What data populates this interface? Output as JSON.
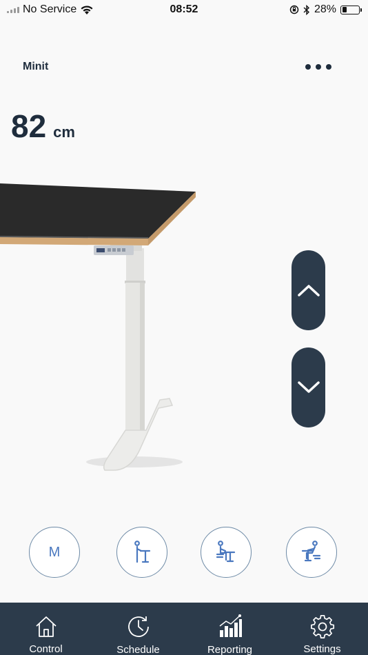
{
  "status_bar": {
    "carrier": "No Service",
    "time": "08:52",
    "battery_percent": "28%",
    "battery_level": 0.28
  },
  "header": {
    "desk_name": "Minit",
    "more_icon": "ellipsis-icon"
  },
  "height": {
    "value": "82",
    "unit": "cm"
  },
  "controls": {
    "up_icon": "chevron-up-icon",
    "down_icon": "chevron-down-icon"
  },
  "presets": {
    "memory_label": "M",
    "items": [
      {
        "icon": "standing-person-icon"
      },
      {
        "icon": "sitting-person-icon"
      },
      {
        "icon": "sitting-lower-person-icon"
      }
    ]
  },
  "tab_bar": {
    "items": [
      {
        "label": "Control",
        "icon": "home-icon"
      },
      {
        "label": "Schedule",
        "icon": "clock-icon"
      },
      {
        "label": "Reporting",
        "icon": "chart-icon"
      },
      {
        "label": "Settings",
        "icon": "gear-icon"
      }
    ]
  },
  "colors": {
    "accent": "#2c3b4b",
    "preset_icon": "#4a78bf",
    "background": "#f9f9f9"
  }
}
